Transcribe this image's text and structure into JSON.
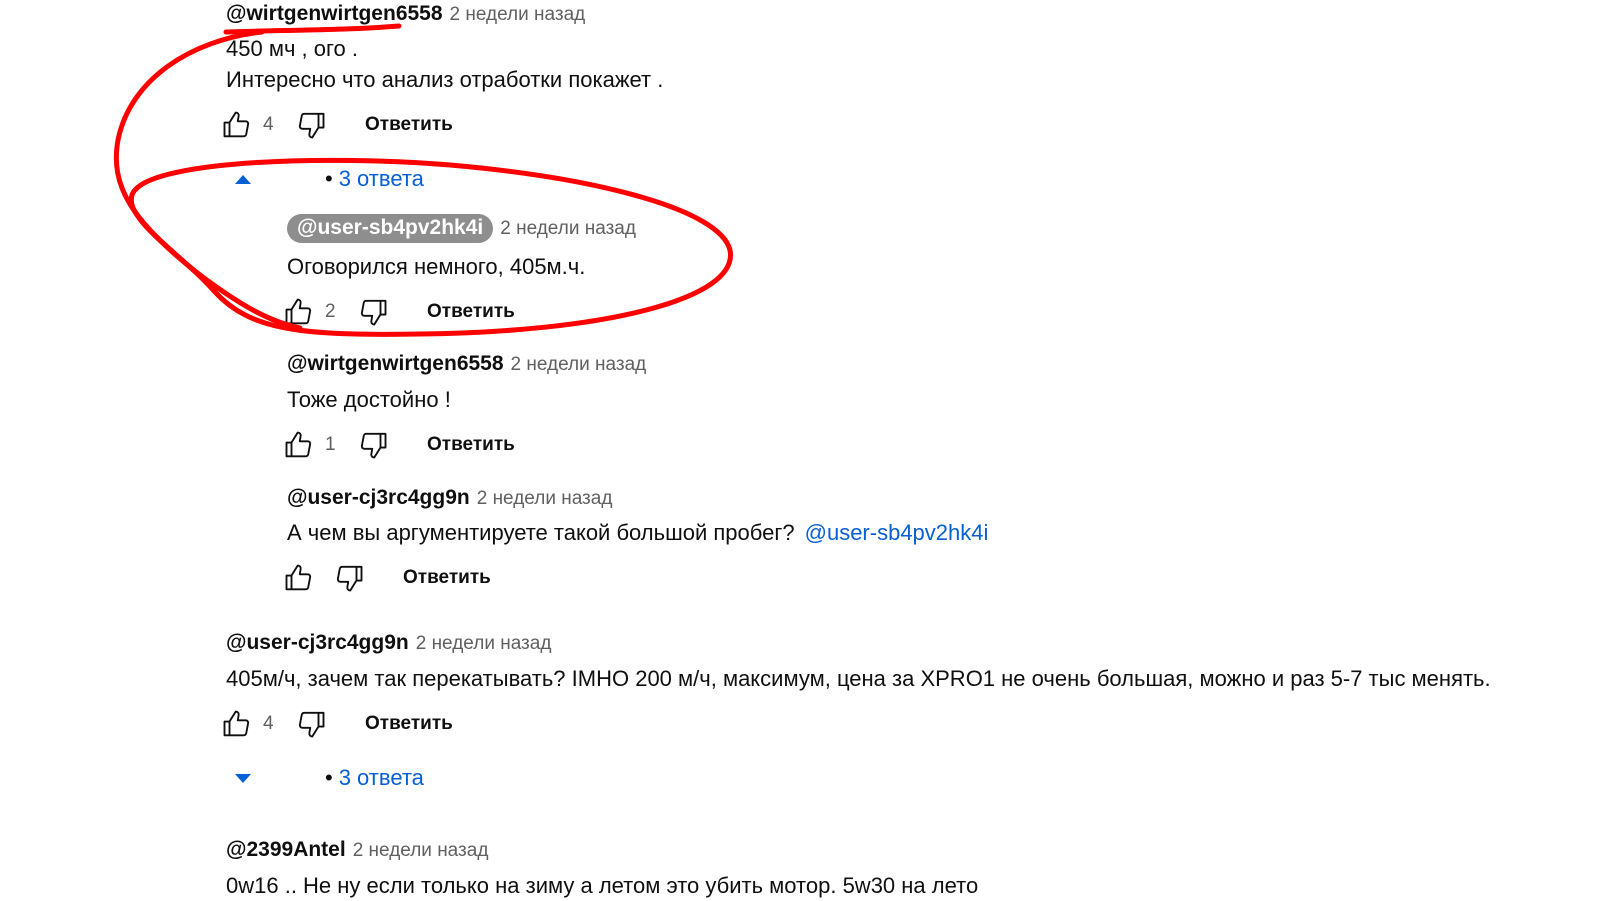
{
  "comments": [
    {
      "author": "@wirtgenwirtgen6558",
      "time": "2 недели назад",
      "text_lines": [
        "450 мч , ого .",
        "Интересно что анализ отработки покажет ."
      ],
      "likes": "4",
      "reply_label": "Ответить",
      "replies_toggle": "3 ответа",
      "replies_expanded": true,
      "replies": [
        {
          "author": "@user-sb4pv2hk4i",
          "author_highlighted": true,
          "time": "2 недели назад",
          "text": "Оговорился немного, 405м.ч.",
          "likes": "2",
          "reply_label": "Ответить"
        },
        {
          "author": "@wirtgenwirtgen6558",
          "time": "2 недели назад",
          "text": "Тоже достойно !",
          "likes": "1",
          "reply_label": "Ответить"
        },
        {
          "author": "@user-cj3rc4gg9n",
          "time": "2 недели назад",
          "text": "А чем вы аргументируете такой большой пробег?",
          "mention": "@user-sb4pv2hk4i",
          "likes": "",
          "reply_label": "Ответить"
        }
      ]
    },
    {
      "author": "@user-cj3rc4gg9n",
      "time": "2 недели назад",
      "text_lines": [
        "405м/ч, зачем так перекатывать? IMHO 200 м/ч, максимум, цена за XPRO1 не очень большая, можно и раз 5-7 тыс менять."
      ],
      "likes": "4",
      "reply_label": "Ответить",
      "replies_toggle": "3 ответа",
      "replies_expanded": false
    },
    {
      "author": "@2399Antel",
      "time": "2 недели назад",
      "text_lines": [
        "0w16 .. Не ну если только на зиму а летом это убить мотор. 5w30 на лето"
      ]
    }
  ],
  "colors": {
    "link": "#065fd4",
    "annotation": "#ff0000",
    "secondary_text": "#606060",
    "highlight_chip": "#8e8e8e"
  },
  "icons": {
    "like": "thumbs-up-icon",
    "dislike": "thumbs-down-icon",
    "expand": "caret-down-icon",
    "collapse": "caret-up-icon"
  }
}
